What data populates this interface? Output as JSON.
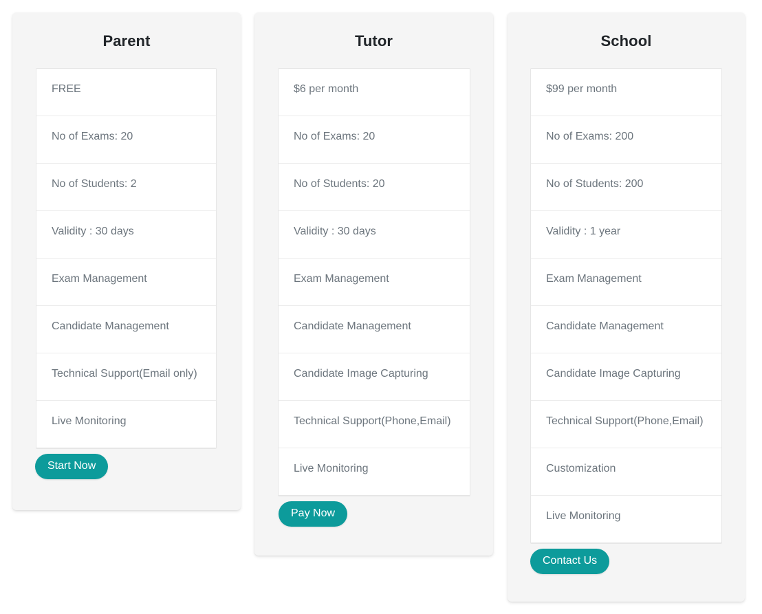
{
  "theme": {
    "accent_color": "#0d9b9b",
    "card_background": "#f5f5f5",
    "list_background": "#ffffff",
    "title_color": "#212529",
    "feature_text_color": "#6c757d",
    "page_background": "#ffffff"
  },
  "plans": [
    {
      "id": "parent",
      "title": "Parent",
      "features": [
        "FREE",
        "No of Exams: 20",
        "No of Students: 2",
        "Validity : 30 days",
        "Exam Management",
        "Candidate Management",
        "Technical Support(Email only)",
        "Live Monitoring"
      ],
      "cta_label": "Start Now"
    },
    {
      "id": "tutor",
      "title": "Tutor",
      "features": [
        "$6 per month",
        "No of Exams: 20",
        "No of Students: 20",
        "Validity : 30 days",
        "Exam Management",
        "Candidate Management",
        "Candidate Image Capturing",
        "Technical Support(Phone,Email)",
        "Live Monitoring"
      ],
      "cta_label": "Pay Now"
    },
    {
      "id": "school",
      "title": "School",
      "features": [
        "$99 per month",
        "No of Exams: 200",
        "No of Students: 200",
        "Validity : 1 year",
        "Exam Management",
        "Candidate Management",
        "Candidate Image Capturing",
        "Technical Support(Phone,Email)",
        "Customization",
        "Live Monitoring"
      ],
      "cta_label": "Contact Us"
    }
  ]
}
